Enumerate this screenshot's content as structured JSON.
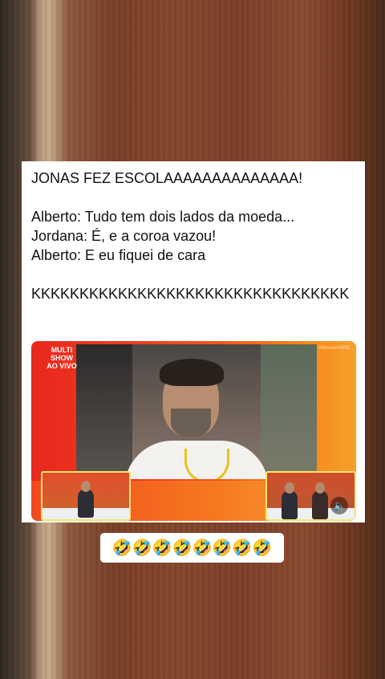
{
  "post": {
    "text": "JONAS FEZ ESCOLAAAAAAAAAAAAAA!\n\nAlberto: Tudo tem dois lados da moeda...\nJordana: É, e a coroa vazou!\nAlberto: E eu fiquei de cara\n\nKKKKKKKKKKKKKKKKKKKKKKKKKKKKKKKKK"
  },
  "video": {
    "badge": "MULTI SHOW AO VIVO",
    "watermark": "#MeseemiBBB",
    "sound_icon": "speaker-icon"
  },
  "reply": {
    "emojis": "🤣🤣🤣🤣🤣🤣🤣🤣"
  },
  "colors": {
    "background_wood": "#7c4029",
    "card": "#ffffff",
    "video_red": "#e8281e",
    "video_orange": "#f7891c"
  }
}
